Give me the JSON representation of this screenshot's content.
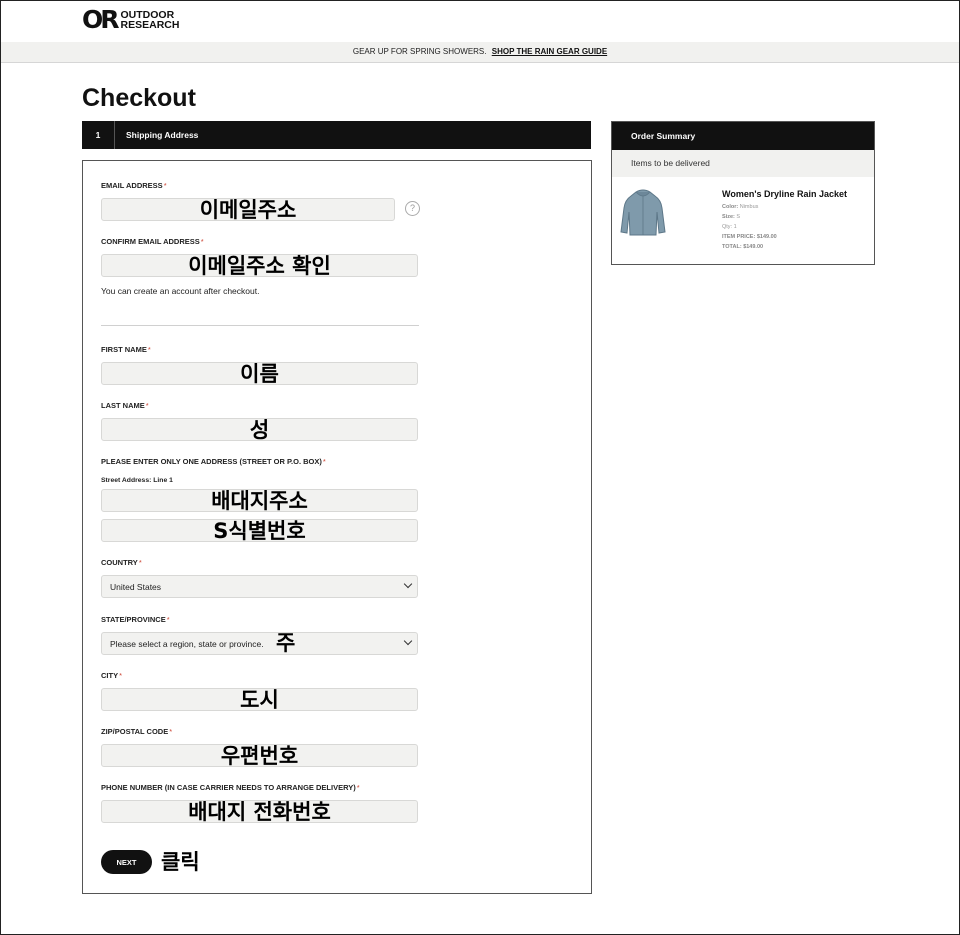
{
  "brand": {
    "mark": "OR",
    "line1": "OUTDOOR",
    "line2": "RESEARCH"
  },
  "promo": {
    "text": "GEAR UP FOR SPRING SHOWERS.",
    "link": "SHOP THE RAIN GEAR GUIDE"
  },
  "page": {
    "title": "Checkout"
  },
  "step": {
    "number": "1",
    "label": "Shipping Address"
  },
  "form": {
    "required_mark": "*",
    "email": {
      "label": "EMAIL ADDRESS",
      "overlay": "이메일주소"
    },
    "confirm_email": {
      "label": "CONFIRM EMAIL ADDRESS",
      "overlay": "이메일주소 확인"
    },
    "account_hint": "You can create an account after checkout.",
    "first_name": {
      "label": "FIRST NAME",
      "overlay": "이름"
    },
    "last_name": {
      "label": "LAST NAME",
      "overlay": "성"
    },
    "address": {
      "label": "PLEASE ENTER ONLY ONE ADDRESS (STREET OR P.O. BOX)",
      "line1_label": "Street Address: Line 1",
      "line1_overlay": "배대지주소",
      "line2_overlay": "S식별번호"
    },
    "country": {
      "label": "COUNTRY",
      "value": "United States"
    },
    "state": {
      "label": "STATE/PROVINCE",
      "value": "Please select a region, state or province.",
      "overlay": "주"
    },
    "city": {
      "label": "CITY",
      "overlay": "도시"
    },
    "zip": {
      "label": "ZIP/POSTAL CODE",
      "overlay": "우편번호"
    },
    "phone": {
      "label": "PHONE NUMBER (IN CASE CARRIER NEEDS TO ARRANGE DELIVERY)",
      "overlay": "배대지 전화번호"
    },
    "next_label": "NEXT",
    "click_note": "클릭"
  },
  "summary": {
    "title": "Order Summary",
    "subtitle": "Items to be delivered",
    "item": {
      "name": "Women's Dryline Rain Jacket",
      "color_label": "Color:",
      "color": "Nimbus",
      "size_label": "Size:",
      "size": "S",
      "qty_label": "Qty:",
      "qty": "1",
      "price_label": "ITEM PRICE:",
      "price": "$149.00",
      "total_label": "TOTAL:",
      "total": "$149.00"
    }
  },
  "colors": {
    "header_bar": "#111111",
    "field_bg": "#f2f2f0",
    "required": "#cc4433",
    "jacket": "#7f9aab"
  }
}
